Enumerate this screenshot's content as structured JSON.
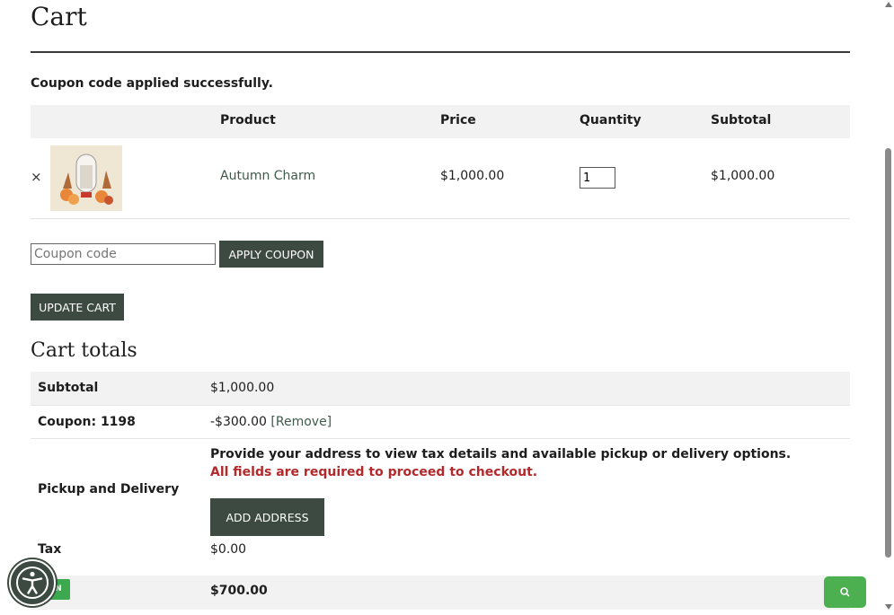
{
  "page": {
    "title": "Cart"
  },
  "notice": "Coupon code applied successfully.",
  "cart_table": {
    "headers": {
      "product": "Product",
      "price": "Price",
      "quantity": "Quantity",
      "subtotal": "Subtotal"
    },
    "items": [
      {
        "remove": "×",
        "name": "Autumn Charm",
        "price": "$1,000.00",
        "quantity": "1",
        "subtotal": "$1,000.00"
      }
    ]
  },
  "coupon": {
    "placeholder": "Coupon code",
    "apply_label": "APPLY COUPON"
  },
  "update_label": "UPDATE CART",
  "totals": {
    "title": "Cart totals",
    "subtotal_label": "Subtotal",
    "subtotal_value": "$1,000.00",
    "coupon_label": "Coupon: 1198",
    "coupon_value": "-$300.00",
    "coupon_remove": "[Remove]",
    "pickup_label": "Pickup and Delivery",
    "pickup_message": "Provide your address to view tax details and available pickup or delivery options.",
    "pickup_required": "All fields are required to proceed to checkout.",
    "add_address_label": "ADD ADDRESS",
    "tax_label": "Tax",
    "tax_value": "$0.00",
    "total_value": "$700.00"
  },
  "widgets": {
    "green_tag": "N"
  },
  "colors": {
    "accent": "#3c4a41",
    "link": "#3f5a4c",
    "error": "#b3292b",
    "chat": "#4caf50"
  }
}
